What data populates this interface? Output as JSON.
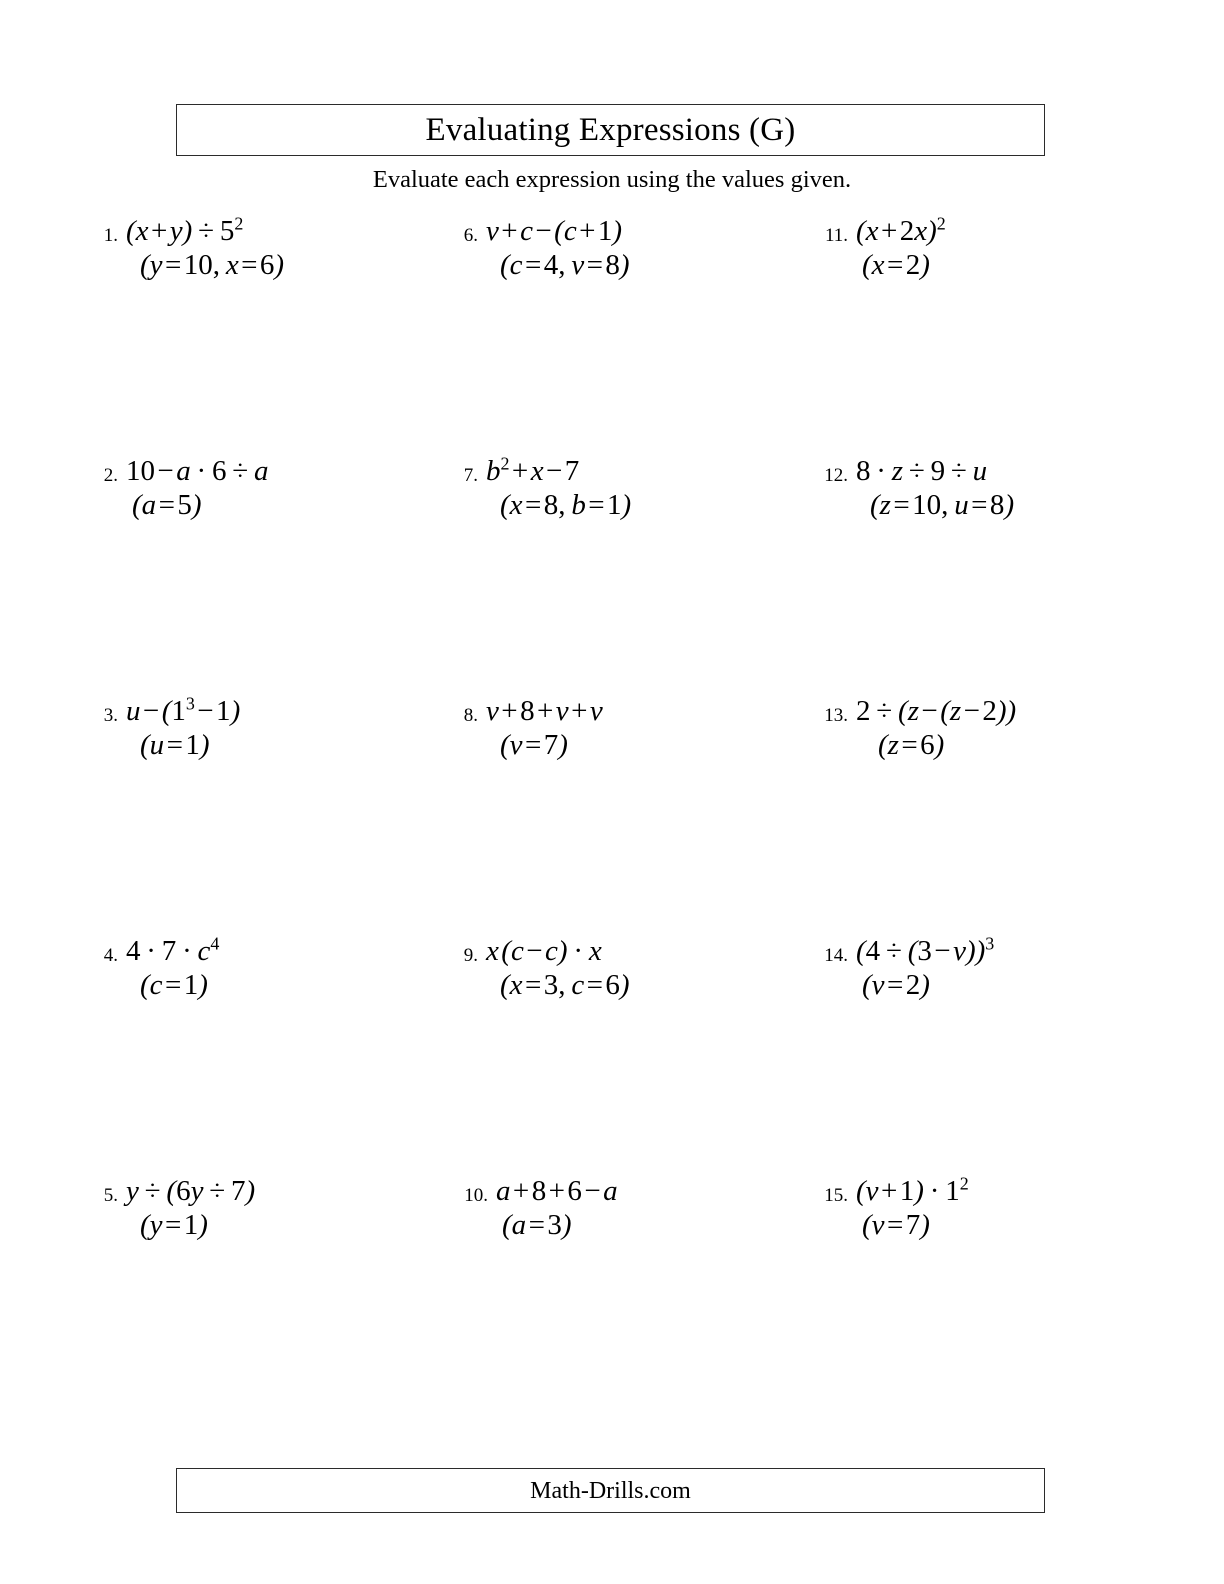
{
  "header": {
    "title": "Evaluating Expressions (G)",
    "instructions": "Evaluate each expression using the values given."
  },
  "footer": {
    "label": "Math-Drills.com"
  },
  "problems": [
    {
      "number": "1.",
      "expression": "(x + y) ÷ 5²",
      "values": "(y = 10, x = 6)"
    },
    {
      "number": "2.",
      "expression": "10 − a · 6 ÷ a",
      "values": "(a = 5)"
    },
    {
      "number": "3.",
      "expression": "u − (1³ − 1)",
      "values": "(u = 1)"
    },
    {
      "number": "4.",
      "expression": "4 · 7 · c⁴",
      "values": "(c = 1)"
    },
    {
      "number": "5.",
      "expression": "y ÷ (6y ÷ 7)",
      "values": "(y = 1)"
    },
    {
      "number": "6.",
      "expression": "v + c − (c + 1)",
      "values": "(c = 4, v = 8)"
    },
    {
      "number": "7.",
      "expression": "b² + x − 7",
      "values": "(x = 8, b = 1)"
    },
    {
      "number": "8.",
      "expression": "v + 8 + v + v",
      "values": "(v = 7)"
    },
    {
      "number": "9.",
      "expression": "x (c − c) · x",
      "values": "(x = 3, c = 6)"
    },
    {
      "number": "10.",
      "expression": "a + 8 + 6 − a",
      "values": "(a = 3)"
    },
    {
      "number": "11.",
      "expression": "(x + 2x)²",
      "values": "(x = 2)"
    },
    {
      "number": "12.",
      "expression": "8 · z ÷ 9 ÷ u",
      "values": "(z = 10, u = 8)"
    },
    {
      "number": "13.",
      "expression": "2 ÷ (z − (z − 2))",
      "values": "(z = 6)"
    },
    {
      "number": "14.",
      "expression": "(4 ÷ (3 − v))³",
      "values": "(v = 2)"
    },
    {
      "number": "15.",
      "expression": "(v + 1) · 1²",
      "values": "(v = 7)"
    }
  ]
}
